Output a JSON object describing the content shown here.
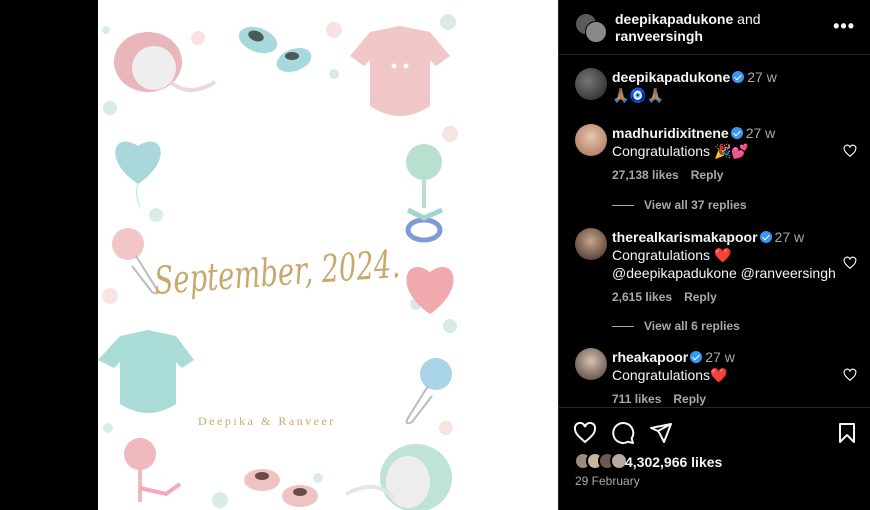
{
  "post": {
    "card_date": "September, 2024.",
    "card_names": "Deepika & Ranveer"
  },
  "header": {
    "author1": "deepikapadukone",
    "joiner": "and",
    "author2": "ranveersingh",
    "more_label": "•••"
  },
  "caption": {
    "username": "deepikapadukone",
    "time": "27 w",
    "text": "🙏🏽🧿🙏🏽"
  },
  "comments": [
    {
      "username": "madhuridixitnene",
      "time": "27 w",
      "text": "Congratulations 🎉💕",
      "likes": "27,138 likes",
      "reply": "Reply",
      "view_replies": "View all 37 replies"
    },
    {
      "username": "therealkarismakapoor",
      "time": "27 w",
      "text": "Congratulations ❤️",
      "text2": "@deepikapadukone @ranveersingh",
      "likes": "2,615 likes",
      "reply": "Reply",
      "view_replies": "View all 6 replies"
    },
    {
      "username": "rheakapoor",
      "time": "27 w",
      "text": "Congratulations❤️",
      "likes": "711 likes",
      "reply": "Reply"
    }
  ],
  "footer": {
    "likes": "4,302,966 likes",
    "date": "29 February"
  },
  "icons": [
    "heart-icon",
    "comment-icon",
    "share-icon",
    "bookmark-icon",
    "more-icon",
    "verified-badge-icon"
  ],
  "colors": {
    "background": "#000000",
    "verified": "#3897f0",
    "secondary_text": "#a8a8a8",
    "card_gold": "#c9a96b"
  }
}
